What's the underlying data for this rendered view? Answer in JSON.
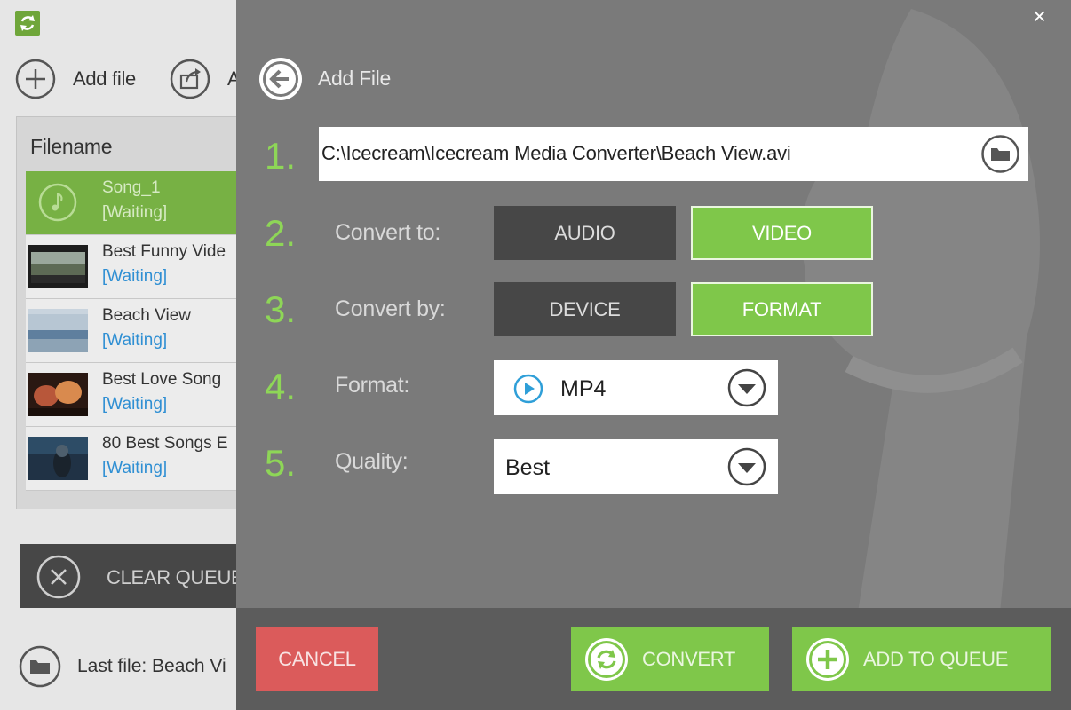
{
  "main": {
    "toolbar": {
      "add_file_label": "Add file",
      "add_url_label": "A"
    },
    "queue": {
      "header": "Filename",
      "items": [
        {
          "name": "Song_1",
          "status": "[Waiting]",
          "selected": true,
          "thumb": "music-icon"
        },
        {
          "name": "Best Funny Vide",
          "status": "[Waiting]",
          "selected": false,
          "thumb": "video-thumbnail"
        },
        {
          "name": "Beach View",
          "status": "[Waiting]",
          "selected": false,
          "thumb": "video-thumbnail"
        },
        {
          "name": "Best Love Song",
          "status": "[Waiting]",
          "selected": false,
          "thumb": "video-thumbnail"
        },
        {
          "name": "80 Best Songs E",
          "status": "[Waiting]",
          "selected": false,
          "thumb": "video-thumbnail"
        }
      ]
    },
    "clear_queue_label": "CLEAR QUEUE",
    "last_file_label": "Last file: Beach Vi"
  },
  "dialog": {
    "close_glyph": "×",
    "title": "Add File",
    "steps": [
      "1.",
      "2.",
      "3.",
      "4.",
      "5."
    ],
    "file_path": "C:\\Icecream\\Icecream Media Converter\\Beach View.avi",
    "convert_to": {
      "label": "Convert to:",
      "options": [
        "AUDIO",
        "VIDEO"
      ],
      "selected": "VIDEO"
    },
    "convert_by": {
      "label": "Convert by:",
      "options": [
        "DEVICE",
        "FORMAT"
      ],
      "selected": "FORMAT"
    },
    "format": {
      "label": "Format:",
      "value": "MP4"
    },
    "quality": {
      "label": "Quality:",
      "value": "Best"
    },
    "buttons": {
      "cancel": "CANCEL",
      "convert": "CONVERT",
      "add_to_queue": "ADD TO QUEUE"
    }
  },
  "colors": {
    "accent_green": "#7fc74a",
    "step_green": "#8ed657",
    "cancel_red": "#db5b5b",
    "overlay_gray": "#7a7a7a",
    "dark_button": "#474747",
    "status_blue": "#2f8fd3"
  }
}
